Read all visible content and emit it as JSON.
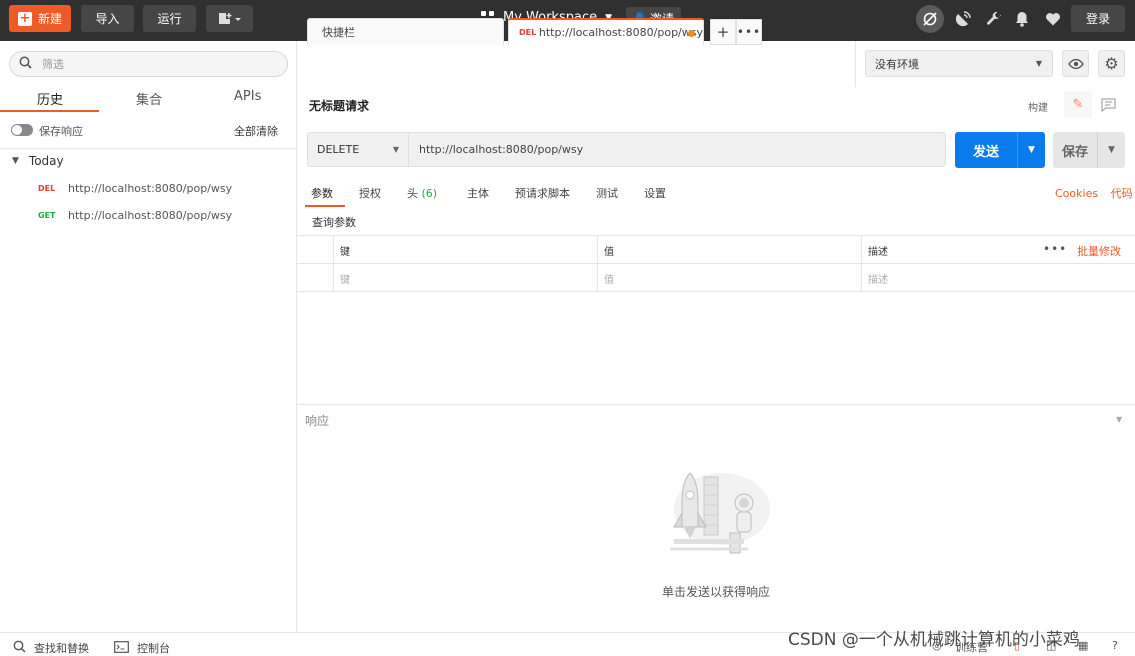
{
  "topbar": {
    "new_label": "新建",
    "import_label": "导入",
    "runner_label": "运行",
    "workspace_title": "My Workspace",
    "invite_label": "邀请",
    "login_label": "登录"
  },
  "sidebar": {
    "search_placeholder": "筛选",
    "tabs": [
      {
        "label": "历史"
      },
      {
        "label": "集合"
      },
      {
        "label": "APIs"
      }
    ],
    "save_responses_label": "保存响应",
    "clear_all_label": "全部清除",
    "group_label": "Today",
    "history": [
      {
        "method": "DEL",
        "url": "http://localhost:8080/pop/wsy"
      },
      {
        "method": "GET",
        "url": "http://localhost:8080/pop/wsy"
      }
    ]
  },
  "tabs": {
    "scratch_label": "快捷栏",
    "active_method": "DEL",
    "active_url": "http://localhost:8080/pop/wsy"
  },
  "environment": {
    "selected": "没有环境"
  },
  "request": {
    "title": "无标题请求",
    "build_label": "构建",
    "method": "DELETE",
    "url": "http://localhost:8080/pop/wsy",
    "send_label": "发送",
    "save_label": "保存",
    "subtabs": [
      {
        "label": "参数"
      },
      {
        "label": "授权"
      },
      {
        "label": "头",
        "count": "(6)"
      },
      {
        "label": "主体"
      },
      {
        "label": "预请求脚本"
      },
      {
        "label": "测试"
      },
      {
        "label": "设置"
      }
    ],
    "cookies_label": "Cookies",
    "code_label": "代码",
    "query_params_title": "查询参数",
    "params_table": {
      "headers": [
        "键",
        "值",
        "描述"
      ],
      "placeholders": [
        "键",
        "值",
        "描述"
      ],
      "bulk_edit_label": "批量修改"
    }
  },
  "response": {
    "title": "响应",
    "empty_message": "单击发送以获得响应"
  },
  "statusbar": {
    "find_replace_label": "查找和替换",
    "console_label": "控制台",
    "bootcamp_label": "训练营"
  },
  "watermark": "CSDN @一个从机械跳计算机的小菜鸡",
  "colors": {
    "brand_orange": "#ef5b25",
    "send_blue": "#097bed",
    "topbar_bg": "#303030"
  }
}
